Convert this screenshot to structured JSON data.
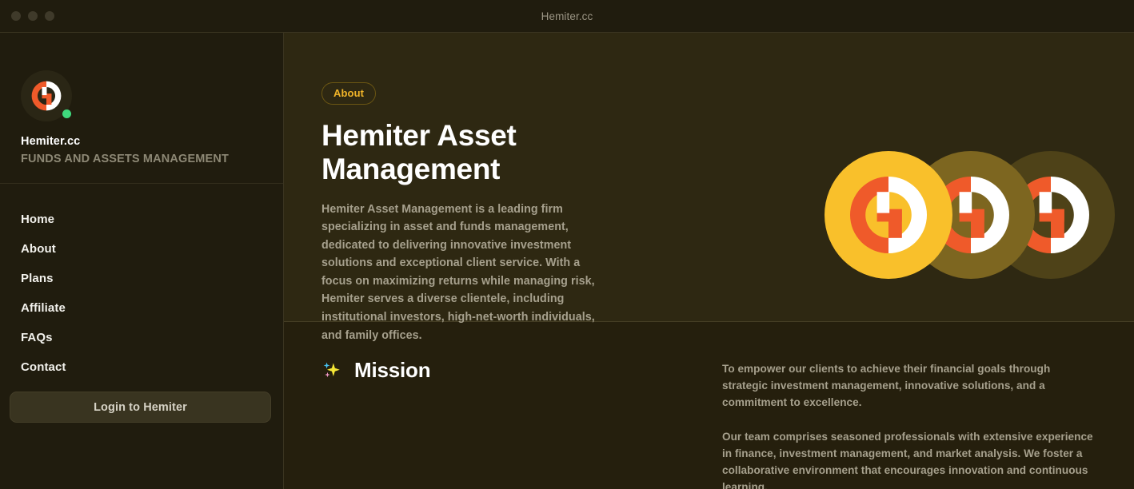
{
  "window": {
    "title": "Hemiter.cc",
    "traffic_lights": [
      "close",
      "minimize",
      "maximize"
    ]
  },
  "sidebar": {
    "brand": {
      "logo_icon": "hemiter-logo-icon",
      "status_icon": "online-status-dot",
      "name": "Hemiter.cc",
      "tagline": "FUNDS AND ASSETS MANAGEMENT"
    },
    "nav": [
      {
        "label": "Home"
      },
      {
        "label": "About"
      },
      {
        "label": "Plans"
      },
      {
        "label": "Affiliate"
      },
      {
        "label": "FAQs"
      },
      {
        "label": "Contact"
      }
    ],
    "login_label": "Login to Hemiter"
  },
  "hero": {
    "badge": "About",
    "title": "Hemiter Asset Management",
    "paragraph": "Hemiter Asset Management is a leading firm specializing in asset and funds management, dedicated to delivering innovative investment solutions and exceptional client service. With a focus on maximizing returns while managing risk, Hemiter serves a diverse clientele, including institutional investors, high-net-worth individuals, and family offices.",
    "coins": [
      {
        "name": "coin-gold",
        "color": "#f9c02b"
      },
      {
        "name": "coin-olive",
        "color": "#7d6620"
      },
      {
        "name": "coin-dark-olive",
        "color": "#4e4218"
      }
    ]
  },
  "mission": {
    "icon": "sparkles-icon",
    "title": "Mission",
    "paragraphs": [
      "To empower our clients to achieve their financial goals through strategic investment management, innovative solutions, and a commitment to excellence.",
      "Our team comprises seasoned professionals with extensive experience in finance, investment management, and market analysis. We foster a collaborative environment that encourages innovation and continuous learning."
    ]
  },
  "colors": {
    "titlebar_bg": "#201c0e",
    "sidebar_bg": "#201c0e",
    "hero_bg": "#2e2812",
    "mission_bg": "#251f0d",
    "accent_amber": "#f0b429",
    "accent_orange": "#ef5a2a",
    "status_green": "#3fd97d",
    "text_primary": "#ffffff",
    "text_muted": "#a6a08d"
  }
}
